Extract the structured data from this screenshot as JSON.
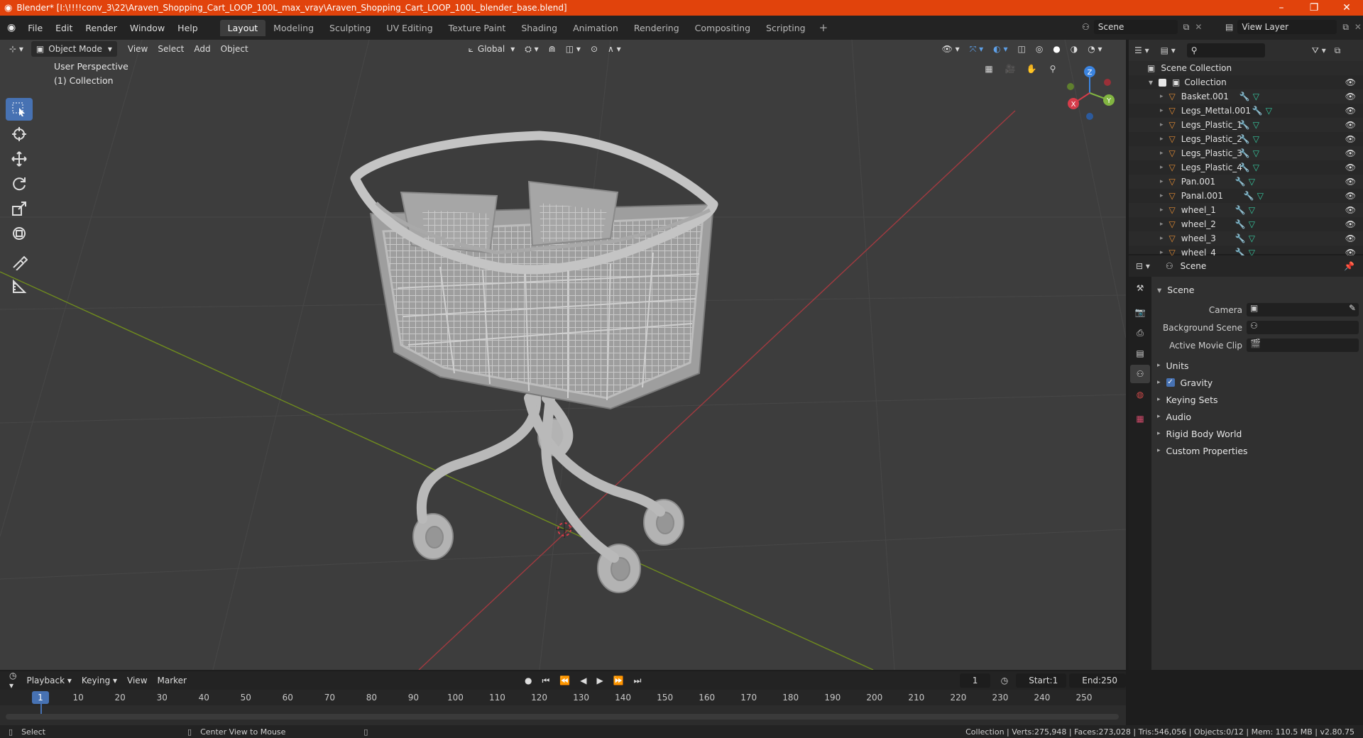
{
  "window": {
    "title": "Blender* [I:\\!!!!conv_3\\22\\Araven_Shopping_Cart_LOOP_100L_max_vray\\Araven_Shopping_Cart_LOOP_100L_blender_base.blend]",
    "minimize": "–",
    "restore": "❐",
    "close": "✕"
  },
  "menu": [
    "File",
    "Edit",
    "Render",
    "Window",
    "Help"
  ],
  "workspaces": [
    "Layout",
    "Modeling",
    "Sculpting",
    "UV Editing",
    "Texture Paint",
    "Shading",
    "Animation",
    "Rendering",
    "Compositing",
    "Scripting"
  ],
  "workspace_add": "+",
  "scene_selector": {
    "value": "Scene"
  },
  "view_layer_selector": {
    "value": "View Layer"
  },
  "viewport": {
    "mode": "Object Mode",
    "menus": [
      "View",
      "Select",
      "Add",
      "Object"
    ],
    "transform_orientation": "Global",
    "perspective_label": "User Perspective",
    "collection_label": "(1) Collection",
    "gizmo": {
      "x": "X",
      "y": "Y",
      "z": "Z"
    }
  },
  "outliner": {
    "root": "Scene Collection",
    "collection": "Collection",
    "objects": [
      "Basket.001",
      "Legs_Mettal.001",
      "Legs_Plastic_1",
      "Legs_Plastic_2",
      "Legs_Plastic_3",
      "Legs_Plastic_4",
      "Pan.001",
      "Panal.001",
      "wheel_1",
      "wheel_2",
      "wheel_3",
      "wheel_4"
    ]
  },
  "properties": {
    "context": "Scene",
    "section": "Scene",
    "fields": [
      {
        "label": "Camera"
      },
      {
        "label": "Background Scene"
      },
      {
        "label": "Active Movie Clip"
      }
    ],
    "panels": [
      "Units",
      "Gravity",
      "Keying Sets",
      "Audio",
      "Rigid Body World",
      "Custom Properties"
    ],
    "gravity_checked": true
  },
  "timeline": {
    "menus": [
      "Playback",
      "Keying",
      "View",
      "Marker"
    ],
    "current_frame": "1",
    "start_label": "Start:",
    "start": "1",
    "end_label": "End:",
    "end": "250",
    "ticks": [
      "10",
      "20",
      "30",
      "40",
      "50",
      "60",
      "70",
      "80",
      "90",
      "100",
      "110",
      "120",
      "130",
      "140",
      "150",
      "160",
      "170",
      "180",
      "190",
      "200",
      "210",
      "220",
      "230",
      "240",
      "250"
    ]
  },
  "status": {
    "left_action": "Select",
    "mid_action": "Center View to Mouse",
    "stats": "Collection | Verts:275,948 | Faces:273,028 | Tris:546,056 | Objects:0/12 | Mem: 110.5 MB | v2.80.75"
  },
  "colors": {
    "accent": "#4772b3",
    "title_bar": "#e1430c",
    "object_icon": "#e08a33",
    "modifier_icon": "#5ea0e8",
    "mesh_icon": "#36c9a0",
    "x_axis": "#d63c4a",
    "y_axis": "#82b541",
    "z_axis": "#3b84e0"
  }
}
